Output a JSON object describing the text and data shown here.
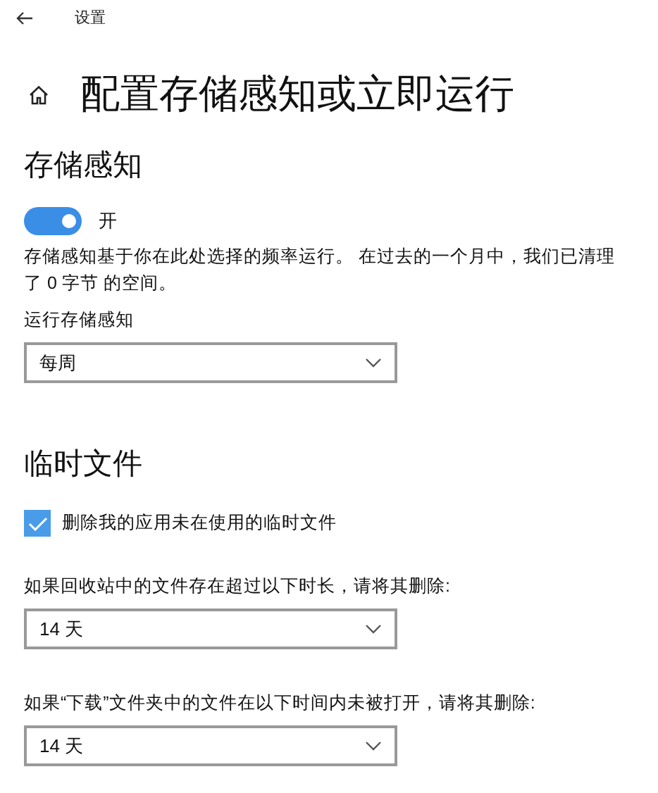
{
  "window": {
    "title": "设置"
  },
  "page_title": "配置存储感知或立即运行",
  "storage_sense": {
    "heading": "存储感知",
    "toggle": {
      "on": true,
      "label": "开"
    },
    "description": "存储感知基于你在此处选择的频率运行。 在过去的一个月中，我们已清理了 0 字节 的空间。",
    "run_label": "运行存储感知",
    "run_dropdown": {
      "value": "每周"
    }
  },
  "temporary_files": {
    "heading": "临时文件",
    "checkbox": {
      "checked": true,
      "label": "删除我的应用未在使用的临时文件"
    },
    "settings": [
      {
        "label": "如果回收站中的文件存在超过以下时长，请将其删除:",
        "value": "14 天"
      },
      {
        "label": "如果“下载”文件夹中的文件在以下时间内未被打开，请将其删除:",
        "value": "14 天"
      }
    ]
  }
}
